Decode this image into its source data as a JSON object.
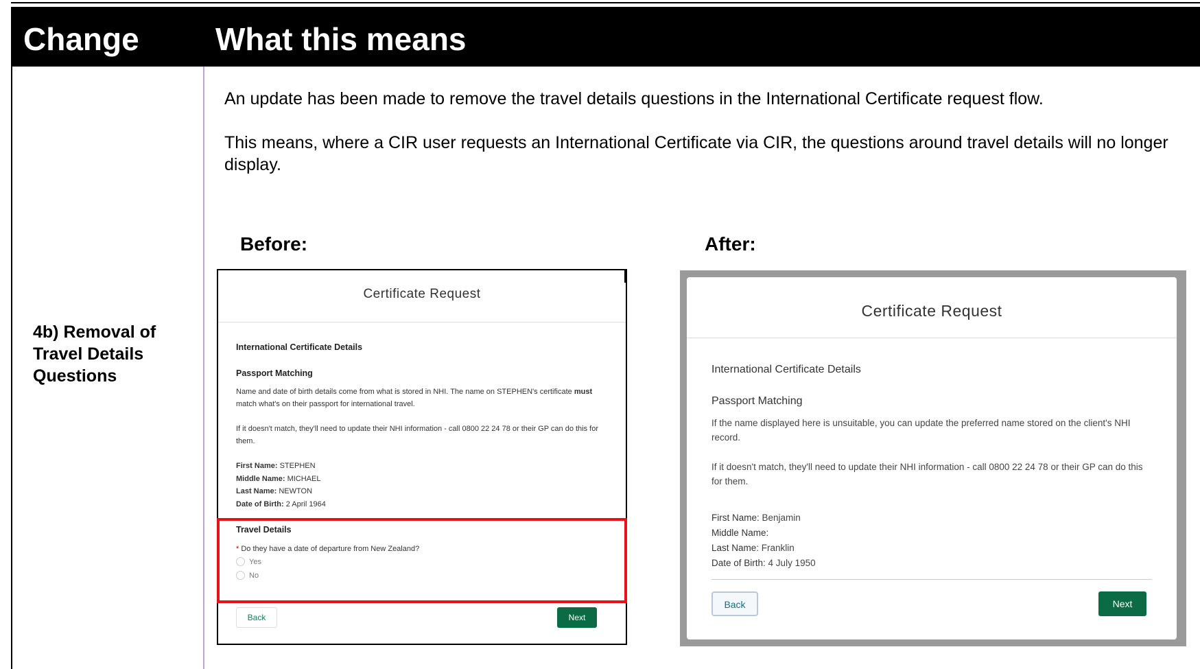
{
  "header": {
    "col1": "Change",
    "col2": "What this means"
  },
  "row": {
    "label_lines": [
      "4b) Removal of",
      "Travel Details",
      "Questions"
    ],
    "para1": "An update has been made to remove the travel details questions in the International Certificate request flow.",
    "para2": "This means, where a CIR user requests an International Certificate via CIR, the questions around travel details will no longer display.",
    "before_caption": "Before:",
    "after_caption": "After:"
  },
  "before": {
    "title": "Certificate Request",
    "section1": "International Certificate Details",
    "section2": "Passport Matching",
    "note1_a": "Name and date of birth details come from what is stored in NHI. The name on STEPHEN's certificate ",
    "note1_bold": "must",
    "note1_b": " match what's on their passport for international travel.",
    "note2": "If it doesn't match, they'll need to update their NHI information - call 0800 22 24 78 or their GP can do this for them.",
    "fields": [
      {
        "label": "First Name:",
        "value": " STEPHEN"
      },
      {
        "label": "Middle Name:",
        "value": " MICHAEL"
      },
      {
        "label": "Last Name:",
        "value": " NEWTON"
      },
      {
        "label": "Date of Birth:",
        "value": " 2 April 1964"
      }
    ],
    "travel_heading": "Travel Details",
    "question_req": "*",
    "question": "Do they have a date of departure from New Zealand?",
    "option_yes": "Yes",
    "option_no": "No",
    "back": "Back",
    "next": "Next"
  },
  "after": {
    "title": "Certificate Request",
    "section1": "International Certificate Details",
    "section2": "Passport Matching",
    "note1": "If the name displayed here is unsuitable, you can update the preferred name stored on the client's NHI record.",
    "note2": "If it doesn't match, they'll need to update their NHI information - call 0800 22 24 78 or their GP can do this for them.",
    "fields": [
      {
        "label": "First Name:",
        "value": " Benjamin"
      },
      {
        "label": "Middle Name:",
        "value": ""
      },
      {
        "label": "Last Name:",
        "value": " Franklin"
      },
      {
        "label": "Date of Birth:",
        "value": " 4 July 1950"
      }
    ],
    "back": "Back",
    "next": "Next"
  },
  "colors": {
    "header_bg": "#000000",
    "highlight": "#e8101a",
    "next_button": "#0a6b45",
    "divider": "#b9a6d6"
  }
}
